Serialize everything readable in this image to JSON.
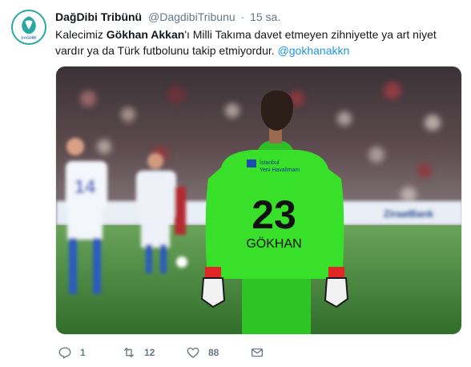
{
  "tweet": {
    "avatar_text": "DAĞDİBİ",
    "display_name": "DağDibi Tribünü",
    "handle": "@DagdibiTribunu",
    "separator": "·",
    "time": "15 sa.",
    "text_part1": "Kalecimiz ",
    "text_bold": "Gökhan Akkan",
    "text_part2": "'ı Milli Takıma davet etmeyen zihniyette ya art niyet vardır ya da Türk futbolunu takip etmiyordur. ",
    "mention": "@gokhanakkn"
  },
  "media": {
    "jersey_sponsor_line1": "İstanbul",
    "jersey_sponsor_line2": "Yeni Havalimanı",
    "jersey_number": "23",
    "jersey_name": "GÖKHAN",
    "board_text": "ZiraatBank",
    "opponent_number": "14"
  },
  "actions": {
    "reply_count": "1",
    "retweet_count": "12",
    "like_count": "88"
  },
  "colors": {
    "mention": "#1b95e0",
    "muted": "#657786",
    "jersey": "#39e02a",
    "pitch": "#3f8a36"
  }
}
